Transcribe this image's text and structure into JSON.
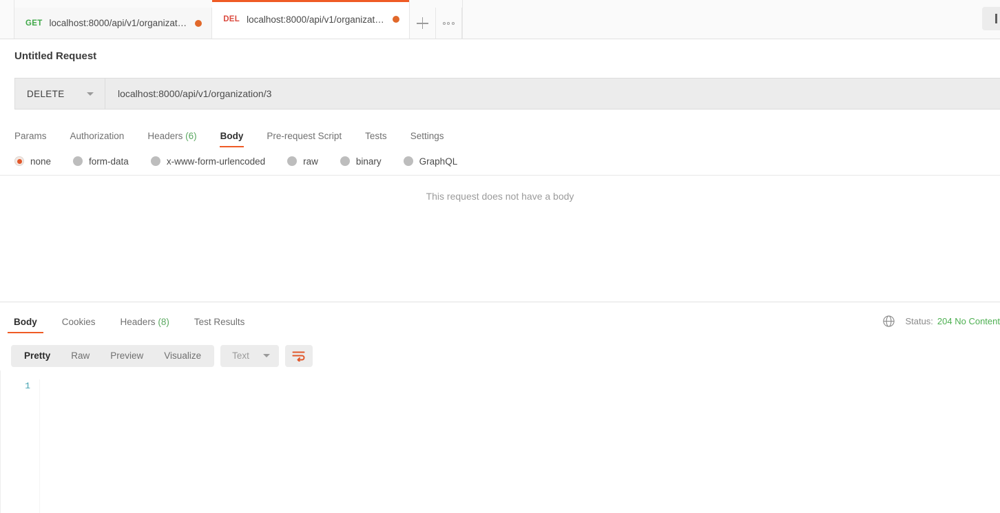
{
  "tabbar": {
    "tabs": [
      {
        "method": "GET",
        "method_class": "get",
        "label": "localhost:8000/api/v1/organizat…",
        "unsaved": true,
        "active": false
      },
      {
        "method": "DEL",
        "method_class": "del",
        "label": "localhost:8000/api/v1/organizat…",
        "unsaved": true,
        "active": true
      }
    ],
    "new_tab_label": "+",
    "more_label": "•••"
  },
  "request": {
    "title": "Untitled Request",
    "method": "DELETE",
    "url": "localhost:8000/api/v1/organization/3",
    "url_placeholder": "Enter request URL",
    "tabs": [
      {
        "label": "Params",
        "count": "",
        "active": false
      },
      {
        "label": "Authorization",
        "count": "",
        "active": false
      },
      {
        "label": "Headers",
        "count": "(6)",
        "active": false
      },
      {
        "label": "Body",
        "count": "",
        "active": true
      },
      {
        "label": "Pre-request Script",
        "count": "",
        "active": false
      },
      {
        "label": "Tests",
        "count": "",
        "active": false
      },
      {
        "label": "Settings",
        "count": "",
        "active": false
      }
    ],
    "body_types": [
      {
        "label": "none",
        "selected": true
      },
      {
        "label": "form-data",
        "selected": false
      },
      {
        "label": "x-www-form-urlencoded",
        "selected": false
      },
      {
        "label": "raw",
        "selected": false
      },
      {
        "label": "binary",
        "selected": false
      },
      {
        "label": "GraphQL",
        "selected": false
      }
    ],
    "empty_body_message": "This request does not have a body"
  },
  "response": {
    "tabs": [
      {
        "label": "Body",
        "count": "",
        "active": true
      },
      {
        "label": "Cookies",
        "count": "",
        "active": false
      },
      {
        "label": "Headers",
        "count": "(8)",
        "active": false
      },
      {
        "label": "Test Results",
        "count": "",
        "active": false
      }
    ],
    "status_label": "Status:",
    "status_value": "204 No Content",
    "view_modes": [
      {
        "label": "Pretty",
        "active": true
      },
      {
        "label": "Raw",
        "active": false
      },
      {
        "label": "Preview",
        "active": false
      },
      {
        "label": "Visualize",
        "active": false
      }
    ],
    "format": "Text",
    "line_numbers": [
      "1"
    ],
    "code_lines": [
      ""
    ]
  },
  "colors": {
    "accent": "#ef5b25",
    "get_method": "#3fa848",
    "del_method": "#db4a3f",
    "status_success": "#4caf50",
    "count_badge": "#5aa860",
    "linenum": "#3f9fae"
  }
}
